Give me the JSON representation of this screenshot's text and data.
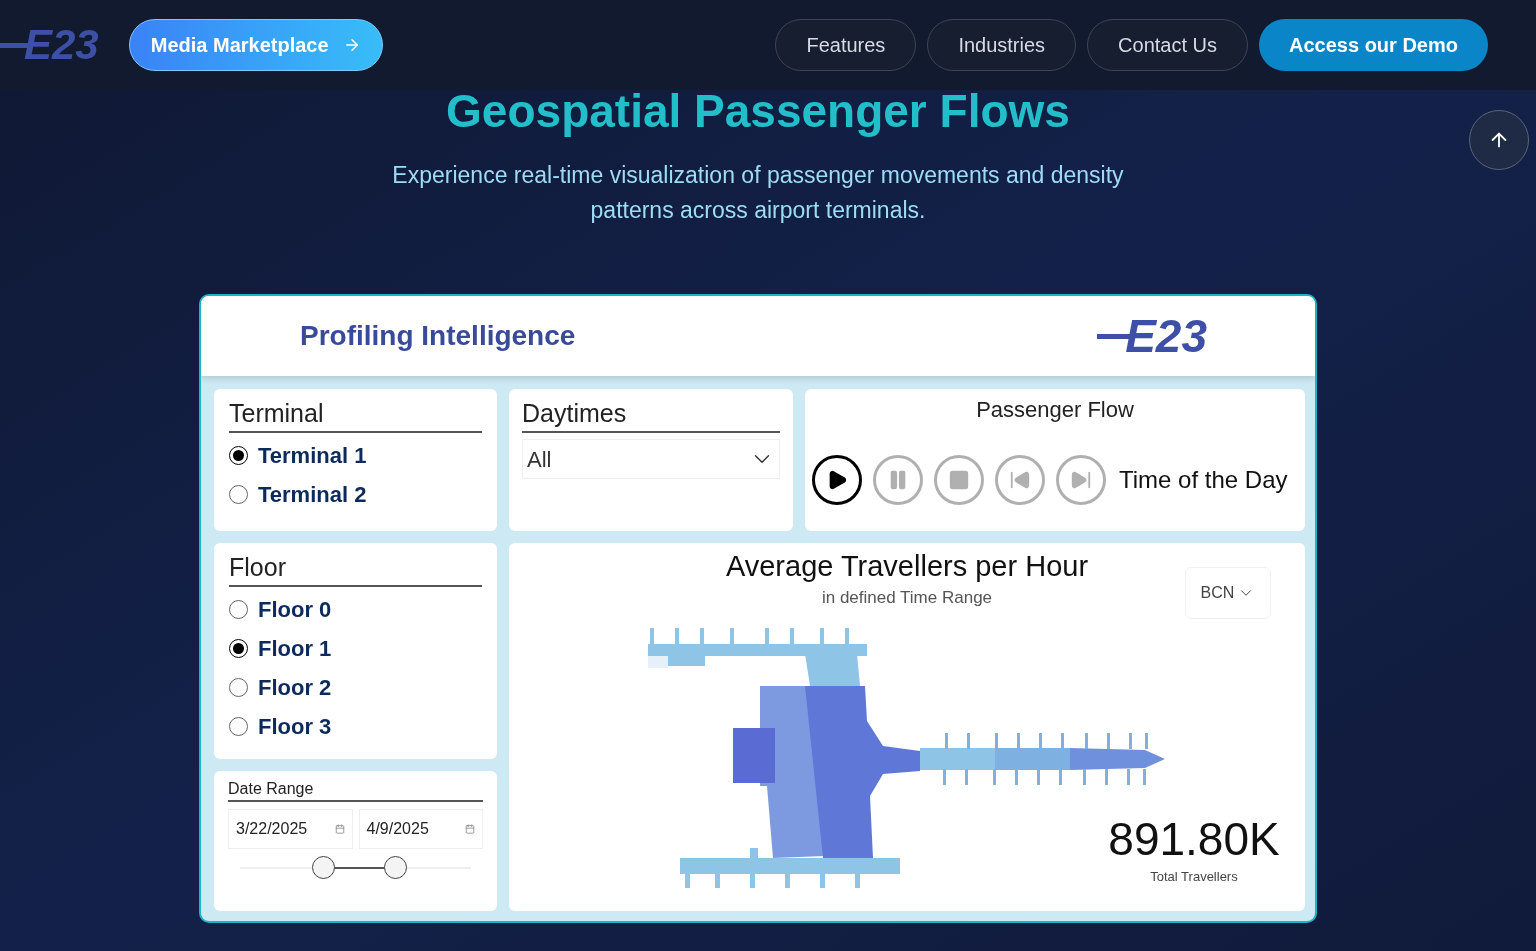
{
  "nav": {
    "logo": "E23",
    "marketplace_button": "Media Marketplace",
    "links": [
      {
        "label": "Features",
        "kind": "outline"
      },
      {
        "label": "Industries",
        "kind": "outline"
      },
      {
        "label": "Contact Us",
        "kind": "outline"
      },
      {
        "label": "Access our Demo",
        "kind": "primary"
      }
    ]
  },
  "hero": {
    "title": "Geospatial Passenger Flows",
    "subtitle": "Experience real-time visualization of passenger movements and density patterns across airport terminals."
  },
  "dashboard": {
    "title": "Profiling Intelligence",
    "logo": "E23",
    "terminal": {
      "label": "Terminal",
      "options": [
        {
          "label": "Terminal 1",
          "selected": true
        },
        {
          "label": "Terminal 2",
          "selected": false
        }
      ]
    },
    "daytimes": {
      "label": "Daytimes",
      "value": "All"
    },
    "floor": {
      "label": "Floor",
      "options": [
        {
          "label": "Floor 0",
          "selected": false
        },
        {
          "label": "Floor 1",
          "selected": true
        },
        {
          "label": "Floor 2",
          "selected": false
        },
        {
          "label": "Floor 3",
          "selected": false
        }
      ]
    },
    "date_range": {
      "label": "Date Range",
      "start": "3/22/2025",
      "end": "4/9/2025",
      "thumbs": [
        {
          "level": 0.36
        },
        {
          "level": 0.67
        }
      ]
    },
    "passenger_flow": {
      "title": "Passenger Flow",
      "label": "Time of the Day",
      "controls": [
        {
          "kind": "play",
          "active": true
        },
        {
          "kind": "pause",
          "active": false
        },
        {
          "kind": "stop",
          "active": false
        },
        {
          "kind": "previous",
          "active": false
        },
        {
          "kind": "next",
          "active": false
        }
      ]
    },
    "chart": {
      "title": "Average Travellers per Hour",
      "subtitle": "in defined Time Range",
      "airport": "BCN",
      "total": "891.80K",
      "total_label": "Total Travellers"
    }
  }
}
